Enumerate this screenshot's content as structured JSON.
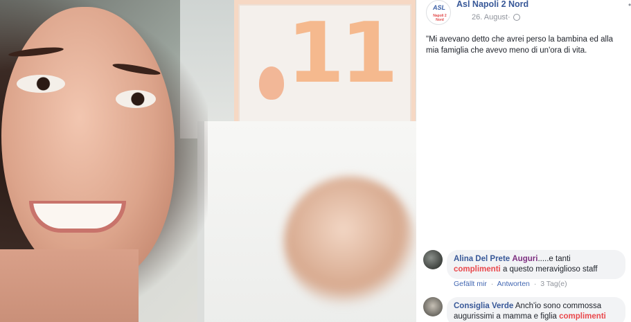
{
  "post": {
    "page_name": "Asl Napoli 2 Nord",
    "avatar_logo_main": "ASL",
    "avatar_logo_sub": "Napoli 2 Nord",
    "date": "26. August",
    "date_separator": "·",
    "text": "\"Mi avevano detto che avrei perso la bambina ed alla mia famiglia che avevo meno di un'ora di vita."
  },
  "photo": {
    "card_number": "11"
  },
  "comments": [
    {
      "author": "Alina Del Prete",
      "tag": "Auguri",
      "text_1": ".....e tanti",
      "highlight": "complimenti",
      "text_2": "a questo meraviglioso staff",
      "like_label": "Gefällt mir",
      "reply_label": "Antworten",
      "separator": "·",
      "age": "3 Tag(e)"
    },
    {
      "author": "Consiglia Verde",
      "text_1": "Anch'io sono commossa augurissimi a mamma e figlia",
      "highlight": "complimenti"
    }
  ],
  "icons": {
    "globe": "globe-icon",
    "more": "more-options-icon"
  }
}
